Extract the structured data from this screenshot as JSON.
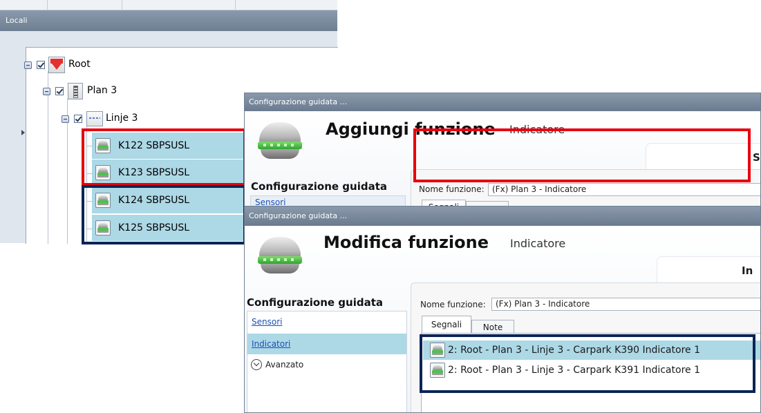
{
  "locali": {
    "title": "Locali",
    "tree": {
      "root_label": "Root",
      "plan_label": "Plan 3",
      "line_label": "Linje 3",
      "devices": [
        {
          "label": "K122 SBPSUSL"
        },
        {
          "label": "K123 SBPSUSL"
        },
        {
          "label": "K124 SBPSUSL"
        },
        {
          "label": "K125 SBPSUSL"
        }
      ]
    }
  },
  "add_dialog": {
    "window_title": "Configurazione guidata ...",
    "heading": "Aggiungi funzione",
    "function_type": "Indicatore",
    "banner_text": "Ser",
    "section_header": "Configurazione guidata",
    "nav_first": "Sensori",
    "name_label": "Nome funzione:",
    "name_value": "(Fx) Plan 3 - Indicatore",
    "tab_signals": "Segnali"
  },
  "edit_dialog": {
    "window_title": "Configurazione guidata ...",
    "heading": "Modifica funzione",
    "function_type": "Indicatore",
    "banner_text": "In",
    "section_header": "Configurazione guidata",
    "nav": {
      "sensors": "Sensori",
      "indicators": "Indicatori",
      "advanced": "Avanzato"
    },
    "name_label": "Nome funzione:",
    "name_value": "(Fx) Plan 3 - Indicatore",
    "tabs": [
      "Segnali",
      "Note"
    ],
    "signals": [
      {
        "text": "2: Root - Plan 3 - Linje 3 - Carpark K390 Indicatore 1"
      },
      {
        "text": "2: Root - Plan 3 - Linje 3 - Carpark K391 Indicatore 1"
      }
    ]
  },
  "colors": {
    "highlight_red": "#e8000e",
    "highlight_navy": "#0c2455",
    "selection_blue": "#add8e6",
    "titlebar": "#7a8a9d"
  }
}
